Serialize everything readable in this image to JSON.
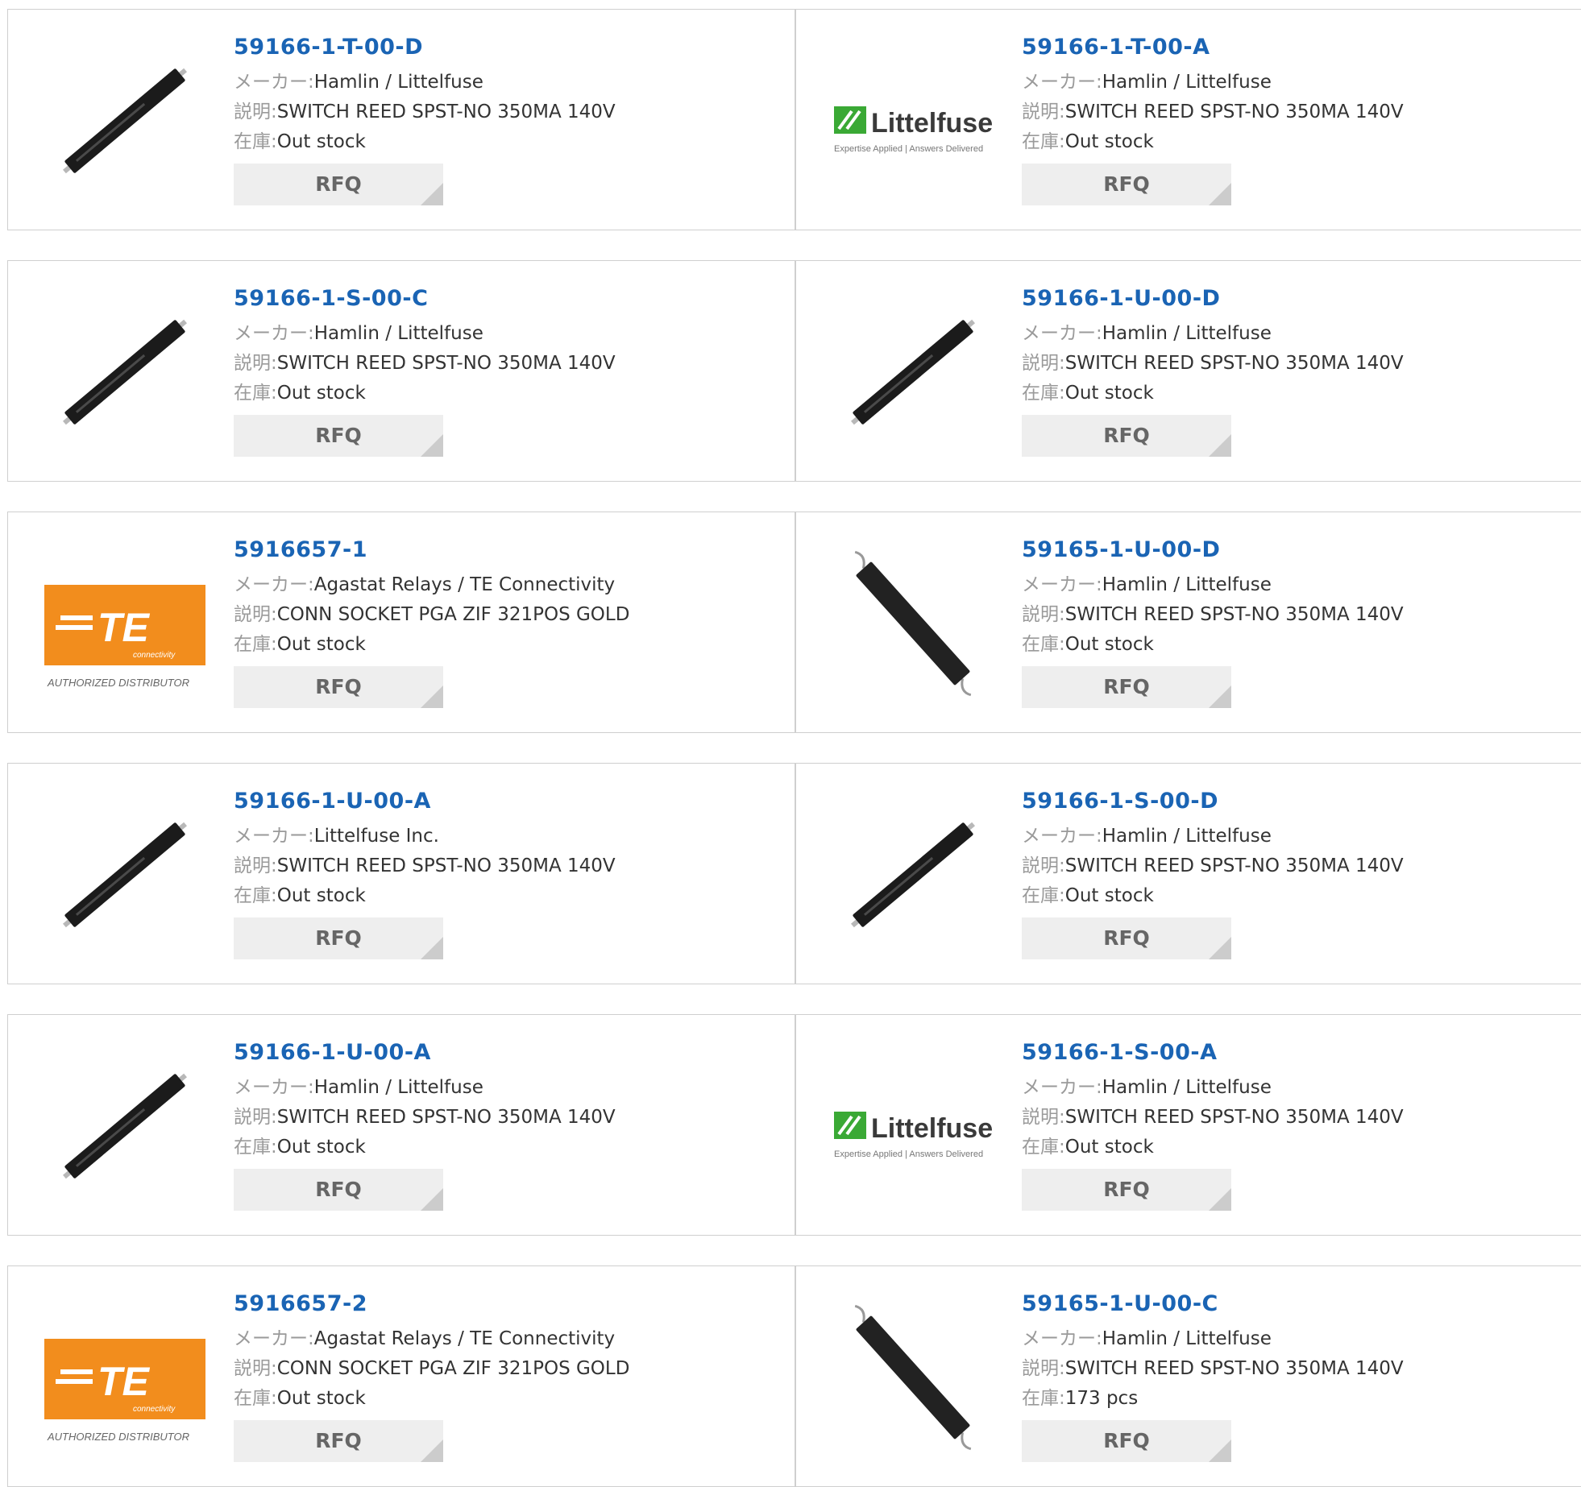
{
  "labels": {
    "manufacturer": "メーカー:",
    "description": "説明:",
    "stock": "在庫:",
    "rfq": "RFQ"
  },
  "colors": {
    "part_link": "#1a64b4",
    "label_gray": "#9a9a9a",
    "rfq_bg": "#eeeeee",
    "te_orange": "#f28d1d",
    "littelfuse_green": "#3aa935"
  },
  "products": [
    {
      "part": "59166-1-T-00-D",
      "manufacturer": "Hamlin / Littelfuse",
      "description": "SWITCH REED SPST-NO 350MA 140V",
      "stock": "Out stock",
      "image": "reed-switch-diagonal"
    },
    {
      "part": "59166-1-T-00-A",
      "manufacturer": "Hamlin / Littelfuse",
      "description": "SWITCH REED SPST-NO 350MA 140V",
      "stock": "Out stock",
      "image": "littelfuse-logo",
      "logo_text": "Littelfuse",
      "logo_tagline": "Expertise Applied | Answers Delivered"
    },
    {
      "part": "59166-1-S-00-C",
      "manufacturer": "Hamlin / Littelfuse",
      "description": "SWITCH REED SPST-NO 350MA 140V",
      "stock": "Out stock",
      "image": "reed-switch-diagonal"
    },
    {
      "part": "59166-1-U-00-D",
      "manufacturer": "Hamlin / Littelfuse",
      "description": "SWITCH REED SPST-NO 350MA 140V",
      "stock": "Out stock",
      "image": "reed-switch-diagonal"
    },
    {
      "part": "5916657-1",
      "manufacturer": "Agastat Relays / TE Connectivity",
      "description": "CONN SOCKET PGA ZIF 321POS GOLD",
      "stock": "Out stock",
      "image": "te-logo",
      "logo_text": "TE",
      "logo_sub": "connectivity",
      "logo_tagline": "AUTHORIZED DISTRIBUTOR"
    },
    {
      "part": "59165-1-U-00-D",
      "manufacturer": "Hamlin / Littelfuse",
      "description": "SWITCH REED SPST-NO 350MA 140V",
      "stock": "Out stock",
      "image": "reed-switch-steep"
    },
    {
      "part": "59166-1-U-00-A",
      "manufacturer": "Littelfuse Inc.",
      "description": "SWITCH REED SPST-NO 350MA 140V",
      "stock": "Out stock",
      "image": "reed-switch-diagonal"
    },
    {
      "part": "59166-1-S-00-D",
      "manufacturer": "Hamlin / Littelfuse",
      "description": "SWITCH REED SPST-NO 350MA 140V",
      "stock": "Out stock",
      "image": "reed-switch-diagonal"
    },
    {
      "part": "59166-1-U-00-A",
      "manufacturer": "Hamlin / Littelfuse",
      "description": "SWITCH REED SPST-NO 350MA 140V",
      "stock": "Out stock",
      "image": "reed-switch-diagonal"
    },
    {
      "part": "59166-1-S-00-A",
      "manufacturer": "Hamlin / Littelfuse",
      "description": "SWITCH REED SPST-NO 350MA 140V",
      "stock": "Out stock",
      "image": "littelfuse-logo",
      "logo_text": "Littelfuse",
      "logo_tagline": "Expertise Applied | Answers Delivered"
    },
    {
      "part": "5916657-2",
      "manufacturer": "Agastat Relays / TE Connectivity",
      "description": "CONN SOCKET PGA ZIF 321POS GOLD",
      "stock": "Out stock",
      "image": "te-logo",
      "logo_text": "TE",
      "logo_sub": "connectivity",
      "logo_tagline": "AUTHORIZED DISTRIBUTOR"
    },
    {
      "part": "59165-1-U-00-C",
      "manufacturer": "Hamlin / Littelfuse",
      "description": "SWITCH REED SPST-NO 350MA 140V",
      "stock": "173 pcs",
      "image": "reed-switch-steep"
    }
  ]
}
